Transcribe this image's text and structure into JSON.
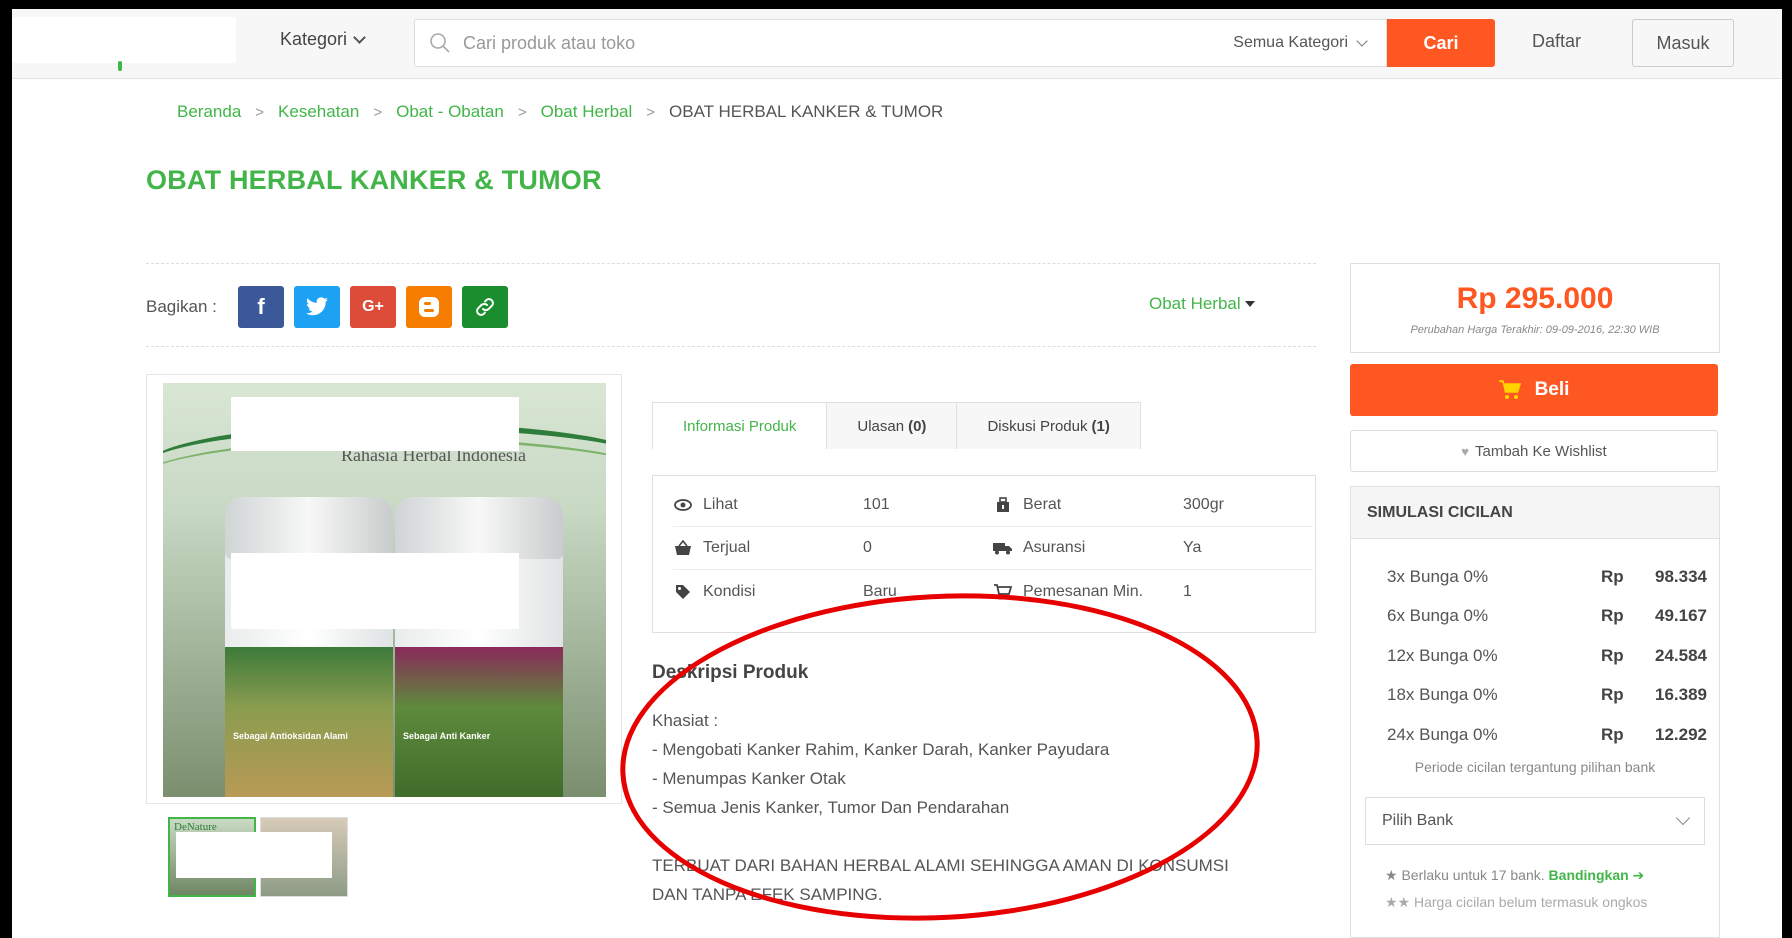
{
  "header": {
    "kategori_label": "Kategori",
    "search_placeholder": "Cari produk atau toko",
    "category_select": "Semua Kategori",
    "search_button": "Cari",
    "register_label": "Daftar",
    "login_label": "Masuk"
  },
  "breadcrumb": [
    "Beranda",
    "Kesehatan",
    "Obat - Obatan",
    "Obat Herbal",
    "OBAT HERBAL KANKER & TUMOR"
  ],
  "breadcrumb_separator": ">",
  "product": {
    "title": "OBAT HERBAL KANKER & TUMOR",
    "share_label": "Bagikan :",
    "category_link": "Obat Herbal",
    "image_tagline": "Rahasia Herbal Indonesia",
    "jar1_label": "Sebagai Antioksidan Alami",
    "jar2_label": "Sebagai Anti Kanker",
    "thumb_label": "DeNature"
  },
  "share_buttons": [
    {
      "icon": "facebook-icon",
      "glyph": "f"
    },
    {
      "icon": "twitter-icon",
      "glyph": "🐦"
    },
    {
      "icon": "google-plus-icon",
      "glyph": "G+"
    },
    {
      "icon": "blogger-icon",
      "glyph": "B"
    },
    {
      "icon": "link-icon",
      "glyph": "🔗"
    }
  ],
  "tabs": [
    {
      "label": "Informasi Produk",
      "count": ""
    },
    {
      "label": "Ulasan",
      "count": "(0)"
    },
    {
      "label": "Diskusi Produk",
      "count": "(1)"
    }
  ],
  "info": {
    "lihat": {
      "label": "Lihat",
      "value": "101"
    },
    "berat": {
      "label": "Berat",
      "value": "300gr"
    },
    "terjual": {
      "label": "Terjual",
      "value": "0"
    },
    "asuransi": {
      "label": "Asuransi",
      "value": "Ya"
    },
    "kondisi": {
      "label": "Kondisi",
      "value": "Baru"
    },
    "pemesanan": {
      "label": "Pemesanan Min.",
      "value": "1"
    }
  },
  "description": {
    "title": "Deskripsi Produk",
    "lines": [
      "Khasiat :",
      "- Mengobati Kanker Rahim, Kanker Darah, Kanker Payudara",
      "- Menumpas Kanker Otak",
      "- Semua Jenis Kanker, Tumor Dan Pendarahan"
    ],
    "paragraph_line1": "TERBUAT DARI BAHAN HERBAL ALAMI SEHINGGA AMAN DI KONSUMSI",
    "paragraph_line2": "DAN TANPA EFEK SAMPING."
  },
  "pricing": {
    "price": "Rp 295.000",
    "price_note": "Perubahan Harga Terakhir: 09-09-2016, 22:30 WIB",
    "buy_label": "Beli",
    "wishlist_label": "Tambah Ke Wishlist"
  },
  "cicilan": {
    "title": "SIMULASI CICILAN",
    "rows": [
      {
        "term": "3x Bunga 0%",
        "currency": "Rp",
        "amount": "98.334"
      },
      {
        "term": "6x Bunga 0%",
        "currency": "Rp",
        "amount": "49.167"
      },
      {
        "term": "12x Bunga 0%",
        "currency": "Rp",
        "amount": "24.584"
      },
      {
        "term": "18x Bunga 0%",
        "currency": "Rp",
        "amount": "16.389"
      },
      {
        "term": "24x Bunga 0%",
        "currency": "Rp",
        "amount": "12.292"
      }
    ],
    "note": "Periode cicilan tergantung pilihan bank",
    "bank_select": "Pilih Bank",
    "footnote1": "★ Berlaku untuk 17 bank.",
    "footnote1_link": "Bandingkan ➔",
    "footnote2": "★★ Harga cicilan belum termasuk ongkos"
  },
  "colors": {
    "brand_green": "#42b549",
    "accent_orange": "#ff5722",
    "annotation_red": "#e60000"
  }
}
